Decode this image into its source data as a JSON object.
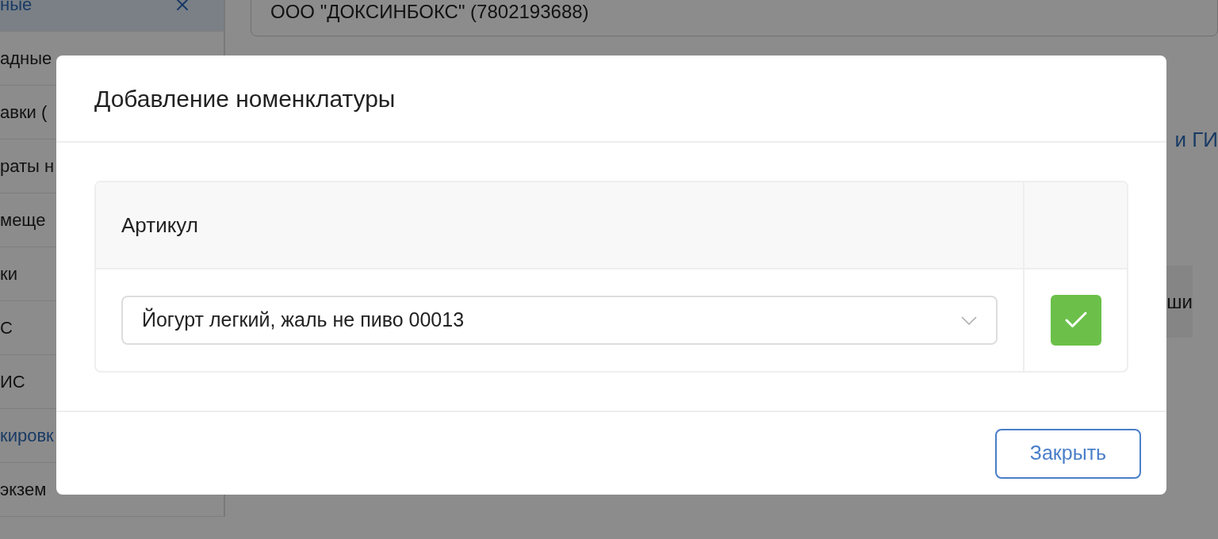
{
  "sidebar": {
    "items": [
      {
        "label": "ные",
        "kind": "section",
        "expanded": true,
        "selected": true
      },
      {
        "label": "адные",
        "kind": "item",
        "selected": false
      },
      {
        "label": "авки (",
        "kind": "item",
        "selected": false
      },
      {
        "label": "раты н",
        "kind": "item",
        "selected": false
      },
      {
        "label": "меще",
        "kind": "item",
        "selected": false
      },
      {
        "label": "ки",
        "kind": "item",
        "selected": false
      },
      {
        "label": "С",
        "kind": "item",
        "selected": false
      },
      {
        "label": "ИС",
        "kind": "item",
        "selected": false
      },
      {
        "label": "кировк",
        "kind": "item",
        "selected": true
      },
      {
        "label": "экзем",
        "kind": "item",
        "selected": false
      }
    ]
  },
  "main": {
    "organization_field": {
      "value": "ООО \"ДОКСИНБОКС\" (7802193688)"
    },
    "link": "и ГИ",
    "cell_text": "ши"
  },
  "modal": {
    "title": "Добавление номенклатуры",
    "table": {
      "columns": [
        "Артикул"
      ],
      "rows": [
        {
          "article": {
            "value": "Йогурт легкий, жаль не пиво 00013"
          }
        }
      ]
    },
    "close_button": "Закрыть"
  }
}
